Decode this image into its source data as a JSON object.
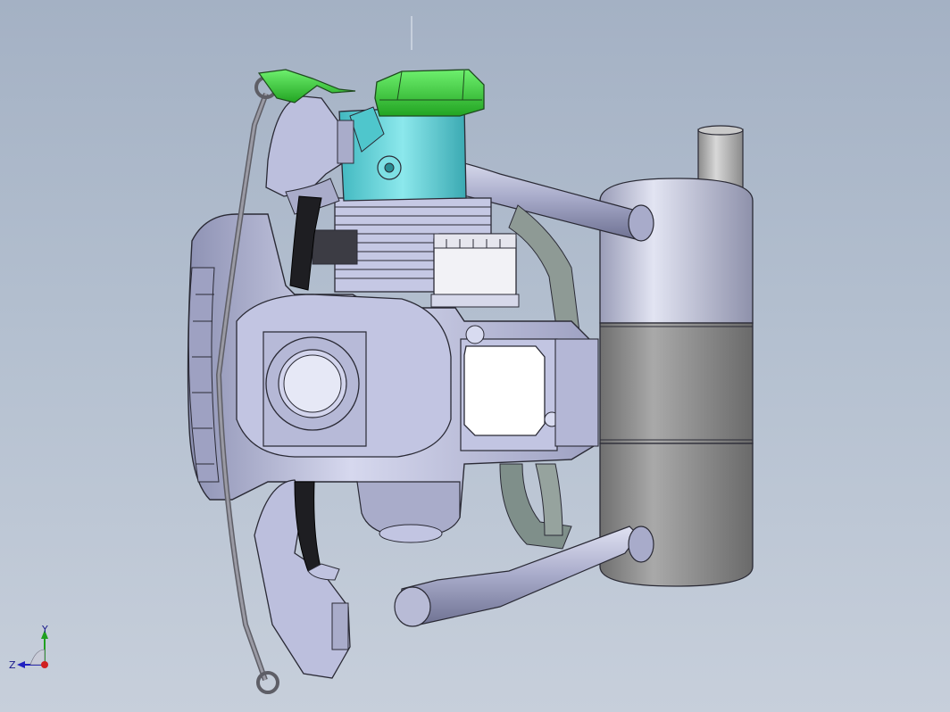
{
  "viewport": {
    "background_top": "#a4b1c4",
    "background_bottom": "#c7cfdb"
  },
  "model": {
    "colors": {
      "body": "#c9cce6",
      "body_shade": "#8e92b4",
      "edge": "#2a2a35",
      "head_cover": "#3cc43c",
      "carb": "#5fd3d8",
      "hose": "#7f8f8a",
      "black_hose": "#1e1e1e",
      "muffler_light": "#c7cadb",
      "muffler_dark": "#8b8b8b",
      "white_part": "#f4f4f4"
    }
  },
  "triad": {
    "y_label": "Y",
    "z_label": "Z",
    "x_color": "#d02020",
    "y_color": "#20a020",
    "z_color": "#2020c0"
  }
}
